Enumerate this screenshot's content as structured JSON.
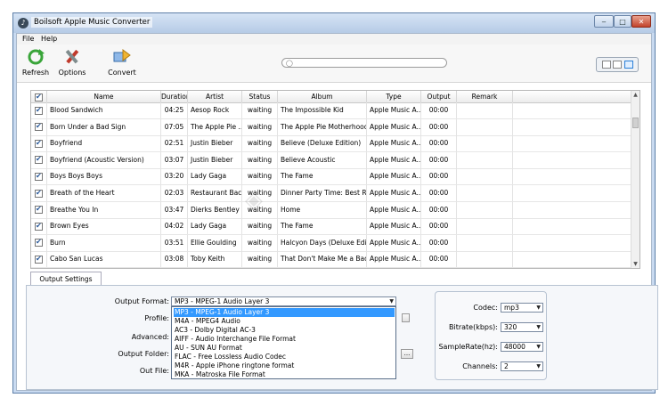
{
  "window": {
    "title": "Boilsoft Apple Music Converter",
    "controls": {
      "minimize": "‒",
      "maximize": "□",
      "close": "✕"
    }
  },
  "menu": [
    "File",
    "Help"
  ],
  "toolbar": {
    "refresh": "Refresh",
    "options": "Options",
    "convert": "Convert"
  },
  "search": {
    "placeholder": "",
    "icon": "search-icon"
  },
  "table": {
    "headers": [
      "",
      "Name",
      "Duration",
      "Artist",
      "Status",
      "Album",
      "Type",
      "Output",
      "Remark"
    ],
    "rows": [
      {
        "name": "Blood Sandwich",
        "duration": "04:25",
        "artist": "Aesop Rock",
        "status": "waiting",
        "album": "The Impossible Kid",
        "type": "Apple Music A...",
        "output": "00:00",
        "remark": ""
      },
      {
        "name": "Born Under a Bad Sign",
        "duration": "07:05",
        "artist": "The Apple Pie ...",
        "status": "waiting",
        "album": "The Apple Pie Motherhood...",
        "type": "Apple Music A...",
        "output": "00:00",
        "remark": ""
      },
      {
        "name": "Boyfriend",
        "duration": "02:51",
        "artist": "Justin Bieber",
        "status": "waiting",
        "album": "Believe (Deluxe Edition)",
        "type": "Apple Music A...",
        "output": "00:00",
        "remark": ""
      },
      {
        "name": "Boyfriend (Acoustic Version)",
        "duration": "03:07",
        "artist": "Justin Bieber",
        "status": "waiting",
        "album": "Believe Acoustic",
        "type": "Apple Music A...",
        "output": "00:00",
        "remark": ""
      },
      {
        "name": "Boys Boys Boys",
        "duration": "03:20",
        "artist": "Lady Gaga",
        "status": "waiting",
        "album": "The Fame",
        "type": "Apple Music A...",
        "output": "00:00",
        "remark": ""
      },
      {
        "name": "Breath of the Heart",
        "duration": "02:03",
        "artist": "Restaurant Bac...",
        "status": "waiting",
        "album": "Dinner Party Time: Best Ro...",
        "type": "Apple Music A...",
        "output": "00:00",
        "remark": ""
      },
      {
        "name": "Breathe You In",
        "duration": "03:47",
        "artist": "Dierks Bentley",
        "status": "waiting",
        "album": "Home",
        "type": "Apple Music A...",
        "output": "00:00",
        "remark": ""
      },
      {
        "name": "Brown Eyes",
        "duration": "04:02",
        "artist": "Lady Gaga",
        "status": "waiting",
        "album": "The Fame",
        "type": "Apple Music A...",
        "output": "00:00",
        "remark": ""
      },
      {
        "name": "Burn",
        "duration": "03:51",
        "artist": "Ellie Goulding",
        "status": "waiting",
        "album": "Halcyon Days (Deluxe Editi...",
        "type": "Apple Music A...",
        "output": "00:00",
        "remark": ""
      },
      {
        "name": "Cabo San Lucas",
        "duration": "03:08",
        "artist": "Toby Keith",
        "status": "waiting",
        "album": "That Don't Make Me a Bad ...",
        "type": "Apple Music A...",
        "output": "00:00",
        "remark": ""
      }
    ]
  },
  "settings": {
    "tab": "Output Settings",
    "output_format_label": "Output Format:",
    "output_format_value": "MP3 - MPEG-1 Audio Layer 3",
    "profile_label": "Profile:",
    "advanced_label": "Advanced:",
    "output_folder_label": "Output Folder:",
    "out_file_label": "Out File:",
    "browse_button": "...",
    "format_options": [
      "MP3 - MPEG-1 Audio Layer 3",
      "M4A - MPEG4 Audio",
      "AC3 - Dolby Digital AC-3",
      "AIFF - Audio Interchange File Format",
      "AU - SUN AU Format",
      "FLAC - Free Lossless Audio Codec",
      "M4R - Apple iPhone ringtone format",
      "MKA - Matroska File Format"
    ],
    "codec_label": "Codec:",
    "codec_value": "mp3",
    "bitrate_label": "Bitrate(kbps):",
    "bitrate_value": "320",
    "samplerate_label": "SampleRate(hz):",
    "samplerate_value": "48000",
    "channels_label": "Channels:",
    "channels_value": "2"
  },
  "colors": {
    "selection": "#3399ff",
    "frame": "#c9daf0"
  }
}
